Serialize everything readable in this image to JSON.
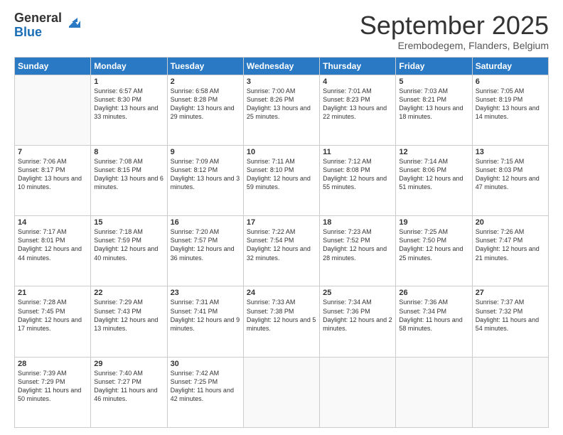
{
  "logo": {
    "general": "General",
    "blue": "Blue"
  },
  "header": {
    "month": "September 2025",
    "location": "Erembodegem, Flanders, Belgium"
  },
  "weekdays": [
    "Sunday",
    "Monday",
    "Tuesday",
    "Wednesday",
    "Thursday",
    "Friday",
    "Saturday"
  ],
  "weeks": [
    [
      {
        "day": "",
        "sunrise": "",
        "sunset": "",
        "daylight": ""
      },
      {
        "day": "1",
        "sunrise": "Sunrise: 6:57 AM",
        "sunset": "Sunset: 8:30 PM",
        "daylight": "Daylight: 13 hours and 33 minutes."
      },
      {
        "day": "2",
        "sunrise": "Sunrise: 6:58 AM",
        "sunset": "Sunset: 8:28 PM",
        "daylight": "Daylight: 13 hours and 29 minutes."
      },
      {
        "day": "3",
        "sunrise": "Sunrise: 7:00 AM",
        "sunset": "Sunset: 8:26 PM",
        "daylight": "Daylight: 13 hours and 25 minutes."
      },
      {
        "day": "4",
        "sunrise": "Sunrise: 7:01 AM",
        "sunset": "Sunset: 8:23 PM",
        "daylight": "Daylight: 13 hours and 22 minutes."
      },
      {
        "day": "5",
        "sunrise": "Sunrise: 7:03 AM",
        "sunset": "Sunset: 8:21 PM",
        "daylight": "Daylight: 13 hours and 18 minutes."
      },
      {
        "day": "6",
        "sunrise": "Sunrise: 7:05 AM",
        "sunset": "Sunset: 8:19 PM",
        "daylight": "Daylight: 13 hours and 14 minutes."
      }
    ],
    [
      {
        "day": "7",
        "sunrise": "Sunrise: 7:06 AM",
        "sunset": "Sunset: 8:17 PM",
        "daylight": "Daylight: 13 hours and 10 minutes."
      },
      {
        "day": "8",
        "sunrise": "Sunrise: 7:08 AM",
        "sunset": "Sunset: 8:15 PM",
        "daylight": "Daylight: 13 hours and 6 minutes."
      },
      {
        "day": "9",
        "sunrise": "Sunrise: 7:09 AM",
        "sunset": "Sunset: 8:12 PM",
        "daylight": "Daylight: 13 hours and 3 minutes."
      },
      {
        "day": "10",
        "sunrise": "Sunrise: 7:11 AM",
        "sunset": "Sunset: 8:10 PM",
        "daylight": "Daylight: 12 hours and 59 minutes."
      },
      {
        "day": "11",
        "sunrise": "Sunrise: 7:12 AM",
        "sunset": "Sunset: 8:08 PM",
        "daylight": "Daylight: 12 hours and 55 minutes."
      },
      {
        "day": "12",
        "sunrise": "Sunrise: 7:14 AM",
        "sunset": "Sunset: 8:06 PM",
        "daylight": "Daylight: 12 hours and 51 minutes."
      },
      {
        "day": "13",
        "sunrise": "Sunrise: 7:15 AM",
        "sunset": "Sunset: 8:03 PM",
        "daylight": "Daylight: 12 hours and 47 minutes."
      }
    ],
    [
      {
        "day": "14",
        "sunrise": "Sunrise: 7:17 AM",
        "sunset": "Sunset: 8:01 PM",
        "daylight": "Daylight: 12 hours and 44 minutes."
      },
      {
        "day": "15",
        "sunrise": "Sunrise: 7:18 AM",
        "sunset": "Sunset: 7:59 PM",
        "daylight": "Daylight: 12 hours and 40 minutes."
      },
      {
        "day": "16",
        "sunrise": "Sunrise: 7:20 AM",
        "sunset": "Sunset: 7:57 PM",
        "daylight": "Daylight: 12 hours and 36 minutes."
      },
      {
        "day": "17",
        "sunrise": "Sunrise: 7:22 AM",
        "sunset": "Sunset: 7:54 PM",
        "daylight": "Daylight: 12 hours and 32 minutes."
      },
      {
        "day": "18",
        "sunrise": "Sunrise: 7:23 AM",
        "sunset": "Sunset: 7:52 PM",
        "daylight": "Daylight: 12 hours and 28 minutes."
      },
      {
        "day": "19",
        "sunrise": "Sunrise: 7:25 AM",
        "sunset": "Sunset: 7:50 PM",
        "daylight": "Daylight: 12 hours and 25 minutes."
      },
      {
        "day": "20",
        "sunrise": "Sunrise: 7:26 AM",
        "sunset": "Sunset: 7:47 PM",
        "daylight": "Daylight: 12 hours and 21 minutes."
      }
    ],
    [
      {
        "day": "21",
        "sunrise": "Sunrise: 7:28 AM",
        "sunset": "Sunset: 7:45 PM",
        "daylight": "Daylight: 12 hours and 17 minutes."
      },
      {
        "day": "22",
        "sunrise": "Sunrise: 7:29 AM",
        "sunset": "Sunset: 7:43 PM",
        "daylight": "Daylight: 12 hours and 13 minutes."
      },
      {
        "day": "23",
        "sunrise": "Sunrise: 7:31 AM",
        "sunset": "Sunset: 7:41 PM",
        "daylight": "Daylight: 12 hours and 9 minutes."
      },
      {
        "day": "24",
        "sunrise": "Sunrise: 7:33 AM",
        "sunset": "Sunset: 7:38 PM",
        "daylight": "Daylight: 12 hours and 5 minutes."
      },
      {
        "day": "25",
        "sunrise": "Sunrise: 7:34 AM",
        "sunset": "Sunset: 7:36 PM",
        "daylight": "Daylight: 12 hours and 2 minutes."
      },
      {
        "day": "26",
        "sunrise": "Sunrise: 7:36 AM",
        "sunset": "Sunset: 7:34 PM",
        "daylight": "Daylight: 11 hours and 58 minutes."
      },
      {
        "day": "27",
        "sunrise": "Sunrise: 7:37 AM",
        "sunset": "Sunset: 7:32 PM",
        "daylight": "Daylight: 11 hours and 54 minutes."
      }
    ],
    [
      {
        "day": "28",
        "sunrise": "Sunrise: 7:39 AM",
        "sunset": "Sunset: 7:29 PM",
        "daylight": "Daylight: 11 hours and 50 minutes."
      },
      {
        "day": "29",
        "sunrise": "Sunrise: 7:40 AM",
        "sunset": "Sunset: 7:27 PM",
        "daylight": "Daylight: 11 hours and 46 minutes."
      },
      {
        "day": "30",
        "sunrise": "Sunrise: 7:42 AM",
        "sunset": "Sunset: 7:25 PM",
        "daylight": "Daylight: 11 hours and 42 minutes."
      },
      {
        "day": "",
        "sunrise": "",
        "sunset": "",
        "daylight": ""
      },
      {
        "day": "",
        "sunrise": "",
        "sunset": "",
        "daylight": ""
      },
      {
        "day": "",
        "sunrise": "",
        "sunset": "",
        "daylight": ""
      },
      {
        "day": "",
        "sunrise": "",
        "sunset": "",
        "daylight": ""
      }
    ]
  ]
}
